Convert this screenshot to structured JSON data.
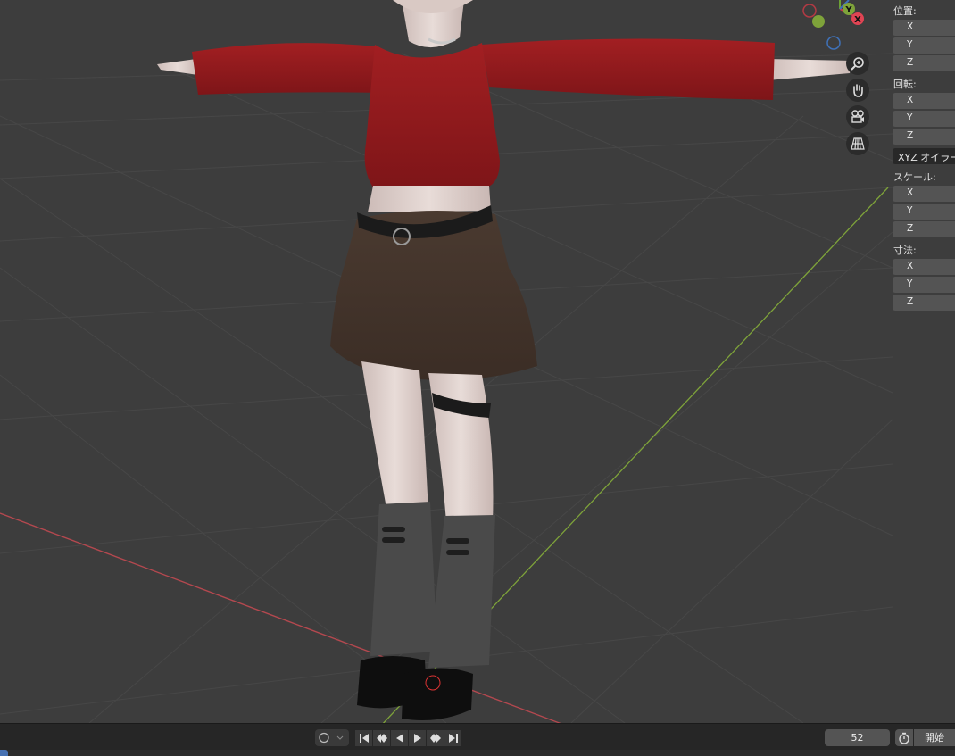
{
  "colors": {
    "viewport_bg": "#3d3d3d",
    "x_axis": "#b4484f",
    "y_axis": "#7ea33a",
    "panel_field": "#545454",
    "timeline_bg": "#262626"
  },
  "gizmo": {
    "y_label": "Y",
    "x_label": "X",
    "icons": [
      "zoom-icon",
      "hand-pan-icon",
      "camera-icon",
      "grid-perspective-icon"
    ]
  },
  "npanel": {
    "location_label": "位置:",
    "rotation_label": "回転:",
    "rotation_mode": "XYZ オイラー",
    "scale_label": "スケール:",
    "dimensions_label": "寸法:",
    "axis_x": "X",
    "axis_y": "Y",
    "axis_z": "Z"
  },
  "timeline": {
    "current_frame": "52",
    "start_label": "開始"
  }
}
